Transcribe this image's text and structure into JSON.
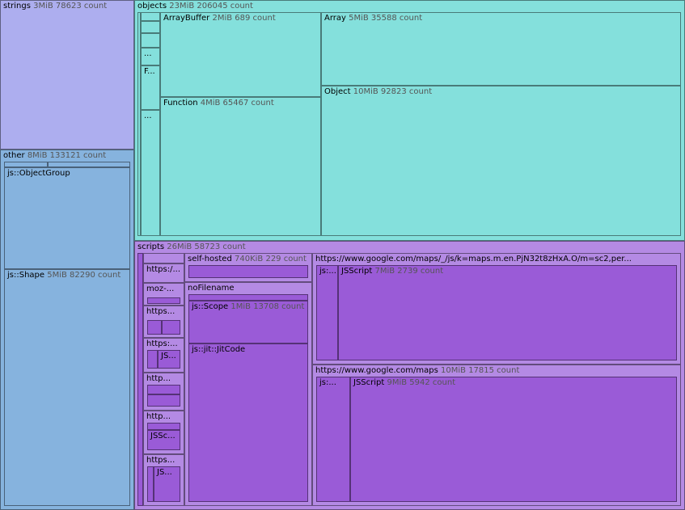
{
  "chart_data": {
    "type": "treemap",
    "colors": {
      "strings": "#adaeef",
      "other": "#86b3de",
      "objects": "#84e0dc",
      "scripts": "#9a5bd7",
      "scripts_light": "#b48ae4"
    },
    "nodes": [
      {
        "id": "strings",
        "group": "strings",
        "name": "strings",
        "metric": "3MiB 78623 count",
        "x": [
          0,
          166
        ],
        "y": [
          0,
          185
        ]
      },
      {
        "id": "other",
        "group": "other",
        "name": "other",
        "metric": "8MiB 133121 count",
        "x": [
          0,
          166
        ],
        "y": [
          185,
          631
        ]
      },
      {
        "id": "other-bar-a",
        "group": "other",
        "name": "",
        "metric": "",
        "x": [
          5,
          59
        ],
        "y": [
          200,
          207
        ]
      },
      {
        "id": "other-bar-b",
        "group": "other",
        "name": "",
        "metric": "",
        "x": [
          59,
          161
        ],
        "y": [
          200,
          207
        ]
      },
      {
        "id": "js-objectgroup",
        "group": "other",
        "name": "js::ObjectGroup",
        "metric": "",
        "x": [
          5,
          161
        ],
        "y": [
          207,
          333
        ]
      },
      {
        "id": "js-shape",
        "group": "other",
        "name": "js::Shape",
        "metric": "5MiB 82290 count",
        "x": [
          5,
          161
        ],
        "y": [
          333,
          626
        ]
      },
      {
        "id": "objects",
        "group": "objects",
        "name": "objects",
        "metric": "23MiB 206045 count",
        "x": [
          166,
          847
        ],
        "y": [
          0,
          298
        ]
      },
      {
        "id": "obj-strip-1",
        "group": "objects",
        "name": "",
        "metric": "",
        "x": [
          170,
          174
        ],
        "y": [
          15,
          292
        ]
      },
      {
        "id": "obj-strip-2",
        "group": "objects",
        "name": "",
        "metric": "",
        "x": [
          174,
          198
        ],
        "y": [
          15,
          26
        ]
      },
      {
        "id": "obj-strip-3",
        "group": "objects",
        "name": "",
        "metric": "",
        "x": [
          174,
          198
        ],
        "y": [
          26,
          41
        ]
      },
      {
        "id": "obj-strip-4",
        "group": "objects",
        "name": "",
        "metric": "",
        "x": [
          174,
          198
        ],
        "y": [
          41,
          59
        ]
      },
      {
        "id": "obj-strip-5",
        "group": "objects",
        "name": "...",
        "metric": "",
        "x": [
          174,
          198
        ],
        "y": [
          59,
          81
        ]
      },
      {
        "id": "obj-strip-6",
        "group": "objects",
        "name": "F...",
        "metric": "",
        "x": [
          174,
          198
        ],
        "y": [
          81,
          136
        ]
      },
      {
        "id": "obj-strip-7",
        "group": "objects",
        "name": "...",
        "metric": "",
        "x": [
          174,
          198
        ],
        "y": [
          136,
          292
        ]
      },
      {
        "id": "arraybuffer",
        "group": "objects",
        "name": "ArrayBuffer",
        "metric": "2MiB 689 count",
        "x": [
          198,
          397
        ],
        "y": [
          15,
          120
        ]
      },
      {
        "id": "function",
        "group": "objects",
        "name": "Function",
        "metric": "4MiB 65467 count",
        "x": [
          198,
          397
        ],
        "y": [
          120,
          292
        ]
      },
      {
        "id": "array",
        "group": "objects",
        "name": "Array",
        "metric": "5MiB 35588 count",
        "x": [
          397,
          842
        ],
        "y": [
          15,
          106
        ]
      },
      {
        "id": "object",
        "group": "objects",
        "name": "Object",
        "metric": "10MiB 92823 count",
        "x": [
          397,
          842
        ],
        "y": [
          106,
          292
        ]
      },
      {
        "id": "scripts",
        "group": "scripts_light",
        "name": "scripts",
        "metric": "26MiB 58723 count",
        "x": [
          166,
          847
        ],
        "y": [
          298,
          631
        ]
      },
      {
        "id": "scr-strip",
        "group": "scripts",
        "name": "",
        "metric": "",
        "x": [
          170,
          177
        ],
        "y": [
          313,
          626
        ]
      },
      {
        "id": "scr-a",
        "group": "scripts_light",
        "name": "",
        "metric": "",
        "x": [
          177,
          228
        ],
        "y": [
          313,
          326
        ]
      },
      {
        "id": "scr-b",
        "group": "scripts_light",
        "name": "https:/...",
        "metric": "",
        "x": [
          177,
          228
        ],
        "y": [
          326,
          350
        ]
      },
      {
        "id": "scr-c",
        "group": "scripts_light",
        "name": "moz-...",
        "metric": "",
        "x": [
          177,
          228
        ],
        "y": [
          350,
          378
        ]
      },
      {
        "id": "scr-c-in",
        "group": "scripts",
        "name": "",
        "metric": "",
        "x": [
          182,
          223
        ],
        "y": [
          368,
          376
        ]
      },
      {
        "id": "scr-d",
        "group": "scripts_light",
        "name": "https...",
        "metric": "",
        "x": [
          177,
          228
        ],
        "y": [
          378,
          418
        ]
      },
      {
        "id": "scr-d-in1",
        "group": "scripts",
        "name": "",
        "metric": "",
        "x": [
          182,
          200
        ],
        "y": [
          396,
          414
        ]
      },
      {
        "id": "scr-d-in2",
        "group": "scripts",
        "name": "",
        "metric": "",
        "x": [
          200,
          223
        ],
        "y": [
          396,
          414
        ]
      },
      {
        "id": "scr-e",
        "group": "scripts_light",
        "name": "https:...",
        "metric": "",
        "x": [
          177,
          228
        ],
        "y": [
          418,
          461
        ]
      },
      {
        "id": "scr-e-in1",
        "group": "scripts",
        "name": "",
        "metric": "",
        "x": [
          182,
          195
        ],
        "y": [
          433,
          456
        ]
      },
      {
        "id": "scr-e-in2",
        "group": "scripts",
        "name": "JS...",
        "metric": "",
        "x": [
          195,
          223
        ],
        "y": [
          433,
          456
        ]
      },
      {
        "id": "scr-f",
        "group": "scripts_light",
        "name": "http...",
        "metric": "",
        "x": [
          177,
          228
        ],
        "y": [
          461,
          508
        ]
      },
      {
        "id": "scr-f-in1",
        "group": "scripts",
        "name": "",
        "metric": "",
        "x": [
          182,
          223
        ],
        "y": [
          476,
          488
        ]
      },
      {
        "id": "scr-f-in2",
        "group": "scripts",
        "name": "",
        "metric": "",
        "x": [
          182,
          223
        ],
        "y": [
          488,
          503
        ]
      },
      {
        "id": "scr-g",
        "group": "scripts_light",
        "name": "http...",
        "metric": "",
        "x": [
          177,
          228
        ],
        "y": [
          508,
          562
        ]
      },
      {
        "id": "scr-g-in1",
        "group": "scripts",
        "name": "",
        "metric": "",
        "x": [
          182,
          223
        ],
        "y": [
          523,
          532
        ]
      },
      {
        "id": "scr-g-in2",
        "group": "scripts",
        "name": "JSSc...",
        "metric": "",
        "x": [
          182,
          223
        ],
        "y": [
          532,
          557
        ]
      },
      {
        "id": "scr-h",
        "group": "scripts_light",
        "name": "https...",
        "metric": "",
        "x": [
          177,
          228
        ],
        "y": [
          562,
          626
        ]
      },
      {
        "id": "scr-h-in1",
        "group": "scripts",
        "name": "",
        "metric": "",
        "x": [
          182,
          190
        ],
        "y": [
          577,
          621
        ]
      },
      {
        "id": "scr-h-in2",
        "group": "scripts",
        "name": "JS...",
        "metric": "",
        "x": [
          190,
          223
        ],
        "y": [
          577,
          621
        ]
      },
      {
        "id": "self-hosted",
        "group": "scripts_light",
        "name": "self-hosted",
        "metric": "740KiB 229 count",
        "x": [
          228,
          386
        ],
        "y": [
          313,
          349
        ]
      },
      {
        "id": "self-hosted-in",
        "group": "scripts",
        "name": "",
        "metric": "",
        "x": [
          233,
          381
        ],
        "y": [
          328,
          344
        ]
      },
      {
        "id": "nofilename",
        "group": "scripts_light",
        "name": "noFilename",
        "metric": "",
        "x": [
          228,
          386
        ],
        "y": [
          349,
          626
        ]
      },
      {
        "id": "nofilename-top",
        "group": "scripts",
        "name": "",
        "metric": "",
        "x": [
          233,
          381
        ],
        "y": [
          364,
          372
        ]
      },
      {
        "id": "js-scope",
        "group": "scripts",
        "name": "js::Scope",
        "metric": "1MiB 13708 count",
        "x": [
          233,
          381
        ],
        "y": [
          372,
          425
        ]
      },
      {
        "id": "js-jitcode",
        "group": "scripts",
        "name": "js::jit::JitCode",
        "metric": "",
        "x": [
          233,
          381
        ],
        "y": [
          425,
          621
        ]
      },
      {
        "id": "maps-js",
        "group": "scripts_light",
        "name": "https://www.google.com/maps/_/js/k=maps.m.en.PjN32t8zHxA.O/m=sc2,per...",
        "metric": "",
        "x": [
          386,
          842
        ],
        "y": [
          313,
          451
        ]
      },
      {
        "id": "maps-js-js",
        "group": "scripts",
        "name": "js:...",
        "metric": "",
        "x": [
          391,
          418
        ],
        "y": [
          328,
          446
        ]
      },
      {
        "id": "maps-js-jsscript",
        "group": "scripts",
        "name": "JSScript",
        "metric": "7MiB 2739 count",
        "x": [
          418,
          837
        ],
        "y": [
          328,
          446
        ]
      },
      {
        "id": "maps",
        "group": "scripts_light",
        "name": "https://www.google.com/maps",
        "metric": "10MiB 17815 count",
        "x": [
          386,
          842
        ],
        "y": [
          451,
          626
        ]
      },
      {
        "id": "maps-js2",
        "group": "scripts",
        "name": "js:...",
        "metric": "",
        "x": [
          391,
          433
        ],
        "y": [
          466,
          621
        ]
      },
      {
        "id": "maps-jsscript",
        "group": "scripts",
        "name": "JSScript",
        "metric": "9MiB 5942 count",
        "x": [
          433,
          837
        ],
        "y": [
          466,
          621
        ]
      }
    ]
  }
}
